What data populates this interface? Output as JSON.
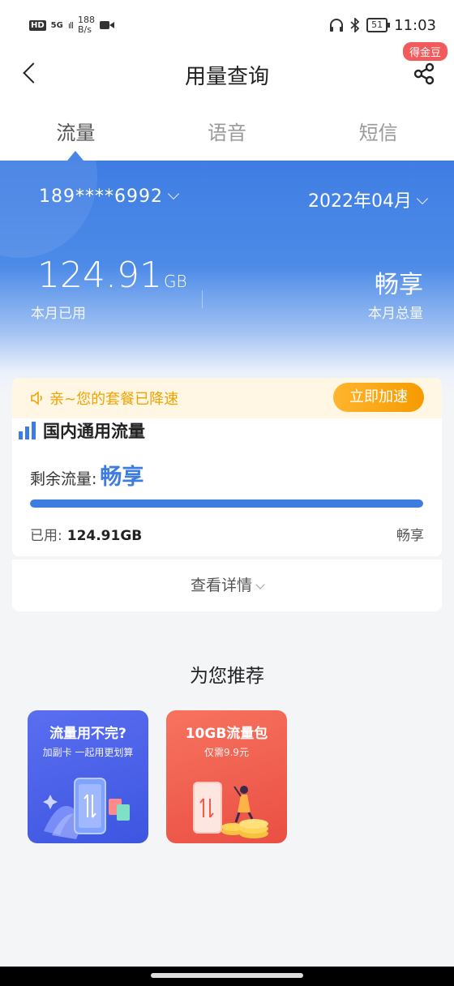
{
  "status_bar": {
    "hd": "HD",
    "net_type": "5G",
    "signal": "ıll",
    "speed_value": "188",
    "speed_unit": "B/s",
    "battery": "51",
    "time": "11:03"
  },
  "nav": {
    "title": "用量查询",
    "badge": "得金豆"
  },
  "tabs": [
    {
      "label": "流量",
      "active": true
    },
    {
      "label": "语音",
      "active": false
    },
    {
      "label": "短信",
      "active": false
    }
  ],
  "hero": {
    "phone": "189****6992",
    "month": "2022年04月",
    "used_value": "124.91",
    "used_unit": "GB",
    "used_label": "本月已用",
    "total_value": "畅享",
    "total_label": "本月总量"
  },
  "card": {
    "notice": "亲~您的套餐已降速",
    "speedup_button": "立即加速",
    "section_title": "国内通用流量",
    "remaining_label": "剩余流量:",
    "remaining_value": "畅享",
    "progress_fraction": 1.0,
    "used_label": "已用:",
    "used_value": "124.91GB",
    "total": "畅享"
  },
  "details_link": "查看详情",
  "recommend": {
    "title": "为您推荐",
    "items": [
      {
        "title": "流量用不完?",
        "subtitle": "加副卡 一起用更划算"
      },
      {
        "title": "10GB流量包",
        "subtitle": "仅需9.9元"
      }
    ]
  },
  "colors": {
    "accent": "#3d7de0",
    "warning": "#f1a100",
    "promo_blue": "#4a60e8",
    "promo_red": "#ef5c4c"
  }
}
